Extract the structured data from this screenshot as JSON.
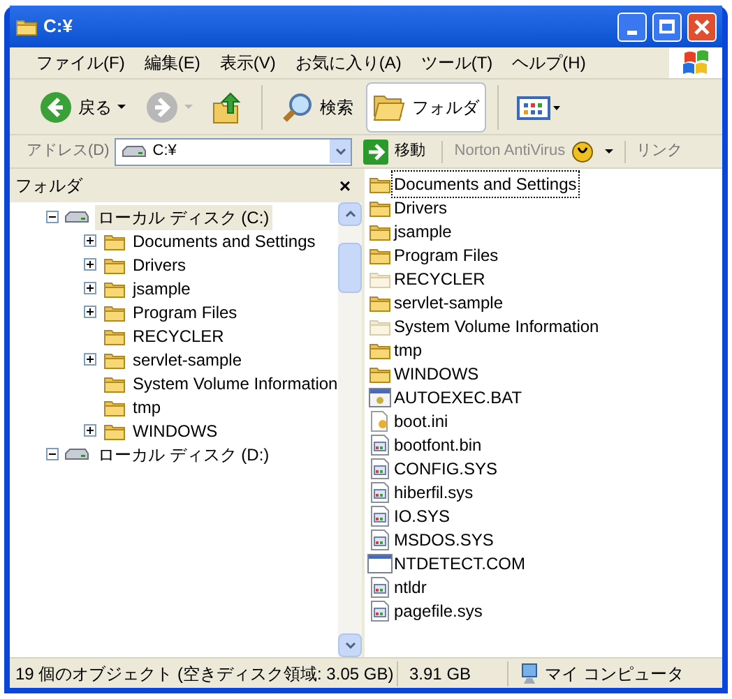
{
  "window": {
    "title": "C:¥"
  },
  "menu": [
    "ファイル(F)",
    "編集(E)",
    "表示(V)",
    "お気に入り(A)",
    "ツール(T)",
    "ヘルプ(H)"
  ],
  "toolbar": [
    {
      "kind": "back",
      "label": "戻る",
      "disabled": false
    },
    {
      "kind": "forward",
      "disabled": true
    },
    {
      "kind": "up"
    },
    {
      "kind": "search",
      "label": "検索"
    },
    {
      "kind": "folders",
      "label": "フォルダ",
      "selected": true
    },
    {
      "kind": "views"
    }
  ],
  "address_bar": {
    "label": "アドレス(D)",
    "value": "C:¥",
    "go": "移動",
    "norton": "Norton AntiVirus",
    "links": "リンク"
  },
  "folder_pane": {
    "title": "フォルダ",
    "close": "×",
    "tree": [
      {
        "label": "ローカル ディスク (C:)",
        "expanded": true,
        "selected": true,
        "children": [
          {
            "label": "Documents and Settings",
            "expandable": true
          },
          {
            "label": "Drivers",
            "expandable": true
          },
          {
            "label": "jsample",
            "expandable": true
          },
          {
            "label": "Program Files",
            "expandable": true
          },
          {
            "label": "RECYCLER",
            "expandable": false
          },
          {
            "label": "servlet-sample",
            "expandable": true
          },
          {
            "label": "System Volume Information",
            "expandable": false
          },
          {
            "label": "tmp",
            "expandable": false
          },
          {
            "label": "WINDOWS",
            "expandable": true
          }
        ]
      },
      {
        "label": "ローカル ディスク (D:)",
        "expanded": true,
        "selected": false
      }
    ]
  },
  "files": [
    {
      "name": "Documents and Settings",
      "kind": "folder",
      "focused": true
    },
    {
      "name": "Drivers",
      "kind": "folder",
      "focused": false
    },
    {
      "name": "jsample",
      "kind": "folder",
      "focused": false
    },
    {
      "name": "Program Files",
      "kind": "folder",
      "focused": false
    },
    {
      "name": "RECYCLER",
      "kind": "hidden_folder",
      "focused": false
    },
    {
      "name": "servlet-sample",
      "kind": "folder",
      "focused": false
    },
    {
      "name": "System Volume Information",
      "kind": "hidden_folder",
      "focused": false
    },
    {
      "name": "tmp",
      "kind": "folder",
      "focused": false
    },
    {
      "name": "WINDOWS",
      "kind": "folder",
      "focused": false
    },
    {
      "name": "AUTOEXEC.BAT",
      "kind": "batch",
      "focused": false
    },
    {
      "name": "boot.ini",
      "kind": "settings",
      "focused": false
    },
    {
      "name": "bootfont.bin",
      "kind": "system",
      "focused": false
    },
    {
      "name": "CONFIG.SYS",
      "kind": "system",
      "focused": false
    },
    {
      "name": "hiberfil.sys",
      "kind": "system",
      "focused": false
    },
    {
      "name": "IO.SYS",
      "kind": "system",
      "focused": false
    },
    {
      "name": "MSDOS.SYS",
      "kind": "system",
      "focused": false
    },
    {
      "name": "NTDETECT.COM",
      "kind": "app",
      "focused": false
    },
    {
      "name": "ntldr",
      "kind": "system",
      "focused": false
    },
    {
      "name": "pagefile.sys",
      "kind": "system",
      "focused": false
    }
  ],
  "status_bar": [
    "19 個のオブジェクト (空きディスク領域: 3.05 GB)",
    "3.91 GB",
    "マイ コンピュータ"
  ]
}
